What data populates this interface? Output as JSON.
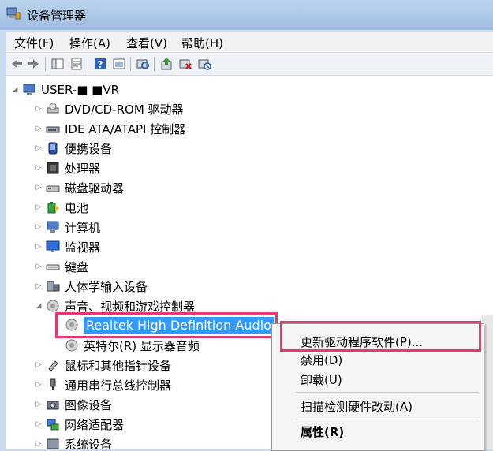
{
  "window": {
    "title": "设备管理器"
  },
  "menu": [
    "文件(F)",
    "操作(A)",
    "查看(V)",
    "帮助(H)"
  ],
  "toolbar_icons": [
    "back-arrow-icon",
    "forward-arrow-icon",
    "console-tree-icon",
    "properties-icon",
    "help-icon",
    "view-icon",
    "scan-hardware-icon",
    "update-driver-icon",
    "uninstall-icon",
    "disable-icon"
  ],
  "tree": {
    "root": "USER-■   ■VR",
    "items": [
      {
        "label": "DVD/CD-ROM 驱动器",
        "icon": "cdrom-icon",
        "expanded": false
      },
      {
        "label": "IDE ATA/ATAPI 控制器",
        "icon": "ide-controller-icon",
        "expanded": false
      },
      {
        "label": "便携设备",
        "icon": "portable-device-icon",
        "expanded": false
      },
      {
        "label": "处理器",
        "icon": "processor-icon",
        "expanded": false
      },
      {
        "label": "磁盘驱动器",
        "icon": "disk-drive-icon",
        "expanded": false
      },
      {
        "label": "电池",
        "icon": "battery-icon",
        "expanded": false
      },
      {
        "label": "计算机",
        "icon": "computer-icon",
        "expanded": false
      },
      {
        "label": "监视器",
        "icon": "monitor-icon",
        "expanded": false
      },
      {
        "label": "键盘",
        "icon": "keyboard-icon",
        "expanded": false
      },
      {
        "label": "人体学输入设备",
        "icon": "hid-icon",
        "expanded": false
      },
      {
        "label": "声音、视频和游戏控制器",
        "icon": "speaker-icon",
        "expanded": true,
        "children": [
          {
            "label": "Realtek High Definition Audio",
            "icon": "speaker-icon",
            "selected": true
          },
          {
            "label": "英特尔(R) 显示器音频",
            "icon": "speaker-icon",
            "selected": false
          }
        ]
      },
      {
        "label": "鼠标和其他指针设备",
        "icon": "mouse-icon",
        "expanded": false
      },
      {
        "label": "通用串行总线控制器",
        "icon": "usb-icon",
        "expanded": false
      },
      {
        "label": "图像设备",
        "icon": "camera-icon",
        "expanded": false
      },
      {
        "label": "网络适配器",
        "icon": "network-icon",
        "expanded": false
      },
      {
        "label": "系统设备",
        "icon": "system-icon",
        "expanded": false
      }
    ]
  },
  "context_menu": {
    "items": [
      "更新驱动程序软件(P)...",
      "禁用(D)",
      "卸载(U)",
      "扫描检测硬件改动(A)",
      "属性(R)"
    ]
  },
  "colors": {
    "highlight": "#3399ff",
    "annotation": "#e8386d",
    "title_bar": "#bcd4ee"
  }
}
